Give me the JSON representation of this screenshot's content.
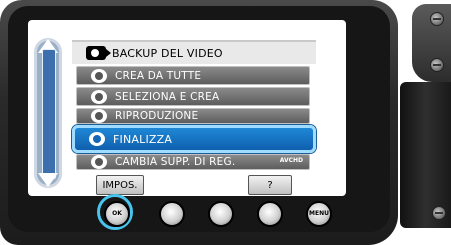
{
  "menu": {
    "title": "BACKUP DEL VIDEO",
    "items": [
      {
        "label": "CREA DA TUTTE"
      },
      {
        "label": "SELEZIONA E CREA"
      },
      {
        "label": "RIPRODUZIONE"
      },
      {
        "label": "FINALIZZA",
        "selected": true
      },
      {
        "label": "CAMBIA SUPP. DI REG."
      }
    ],
    "avchd_badge": "AVCHD"
  },
  "softkeys": {
    "impos_label": "IMPOS.",
    "help_label": "?"
  },
  "buttons": {
    "ok_label": "OK",
    "menu_label": "MENU"
  },
  "colors": {
    "selection": "#1a78c8",
    "selection_border": "#9fdcff",
    "ok_ring": "#48c4ee"
  }
}
